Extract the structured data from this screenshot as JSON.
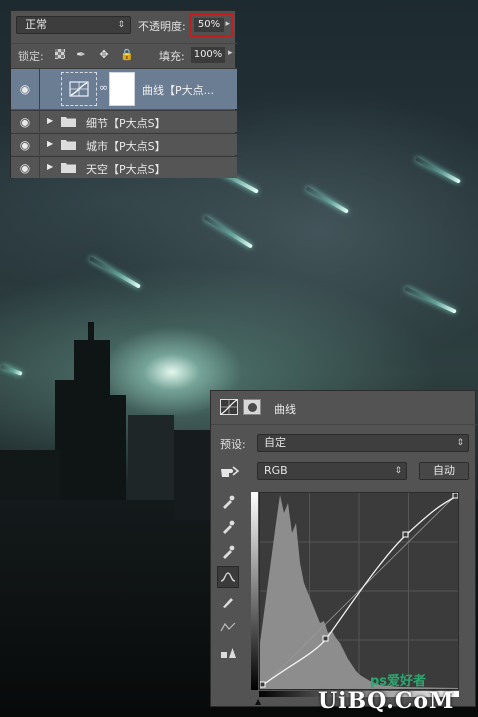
{
  "layers_panel": {
    "blend_mode": "正常",
    "opacity_label": "不透明度:",
    "opacity_value": "50%",
    "lock_label": "锁定:",
    "fill_label": "填充:",
    "fill_value": "100%",
    "layers": [
      {
        "name": "曲线【P大点...",
        "type": "curves"
      },
      {
        "name": "细节【P大点S】",
        "type": "group"
      },
      {
        "name": "城市【P大点S】",
        "type": "group"
      },
      {
        "name": "天空【P大点S】",
        "type": "group"
      }
    ]
  },
  "properties_panel": {
    "title": "曲线",
    "preset_label": "预设:",
    "preset_value": "自定",
    "channel_value": "RGB",
    "auto_button": "自动"
  },
  "watermark": {
    "text": "UiBQ.CoM",
    "sub": "ps爱好者"
  },
  "colors": {
    "panel_bg": "#535353",
    "selected_layer": "#6b7d92",
    "opacity_highlight": "#c41d1d",
    "meteor_glow": "#8cf0dc"
  }
}
